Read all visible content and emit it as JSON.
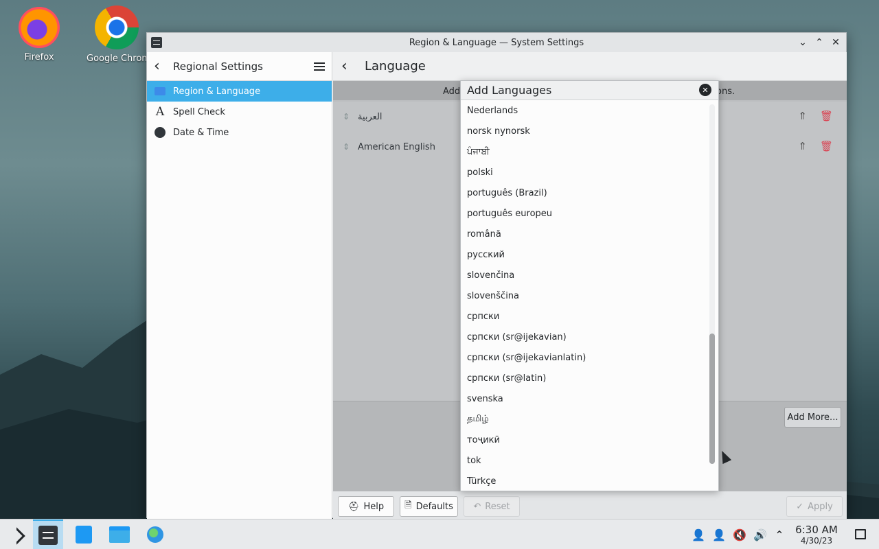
{
  "desktop": {
    "icons": [
      {
        "label": "Firefox",
        "icon": "firefox-icon"
      },
      {
        "label": "Google Chrome",
        "icon": "chrome-icon"
      }
    ]
  },
  "window": {
    "title": "Region & Language — System Settings",
    "controls": {
      "minimize": "⌄",
      "maximize": "⌃",
      "close": "✕"
    }
  },
  "sidebar": {
    "title": "Regional Settings",
    "items": [
      {
        "label": "Region & Language",
        "icon": "region-icon",
        "active": true
      },
      {
        "label": "Spell Check",
        "icon": "spell-check-icon"
      },
      {
        "label": "Date & Time",
        "icon": "clock-icon"
      }
    ]
  },
  "main": {
    "title": "Language",
    "notice_left": "Add",
    "notice_right": "ons.",
    "languages": [
      {
        "name": "العربية"
      },
      {
        "name": "American English"
      }
    ],
    "add_more_label": "Add More..."
  },
  "footer": {
    "help_label": "Help",
    "defaults_label": "Defaults",
    "reset_label": "Reset",
    "apply_label": "Apply"
  },
  "add_languages": {
    "title": "Add Languages",
    "items": [
      "Nederlands",
      "norsk nynorsk",
      "ਪੰਜਾਬੀ",
      "polski",
      "português (Brazil)",
      "português europeu",
      "română",
      "русский",
      "slovenčina",
      "slovenščina",
      "српски",
      "српски (sr@ijekavian)",
      "српски (sr@ijekavianlatin)",
      "српски (sr@latin)",
      "svenska",
      "தமிழ்",
      "тоҷикӣ",
      "tok",
      "Türkçe"
    ],
    "scroll_position": 0.64
  },
  "taskbar": {
    "time": "6:30 AM",
    "date": "4/30/23"
  },
  "colors": {
    "accent": "#3daee9",
    "delete": "#da4453"
  }
}
